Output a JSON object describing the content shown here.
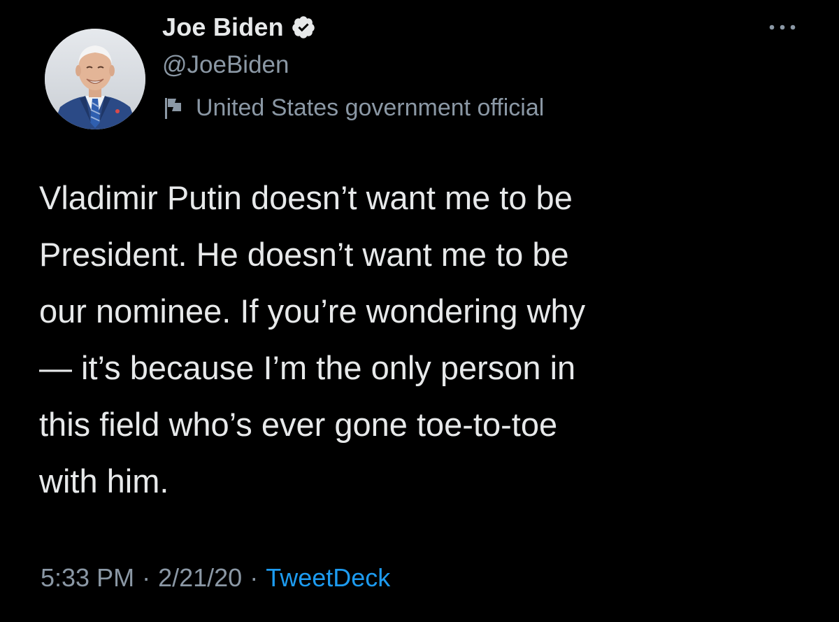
{
  "user": {
    "display_name": "Joe Biden",
    "handle": "@JoeBiden",
    "verified": true,
    "verified_color": "#1d9bf0",
    "label_icon": "flag-icon",
    "label": "United States government official"
  },
  "menu": {
    "icon": "more-icon"
  },
  "tweet": {
    "text": "Vladimir Putin doesn’t want me to be\nPresident. He doesn’t want me to be\nour nominee. If you’re wondering why\n— it’s because I’m the only person in\nthis field who’s ever gone toe-to-toe\nwith him."
  },
  "meta": {
    "time": "5:33 PM",
    "separator": "·",
    "date": "2/21/20",
    "source": "TweetDeck",
    "source_color": "#1d9bf0"
  }
}
